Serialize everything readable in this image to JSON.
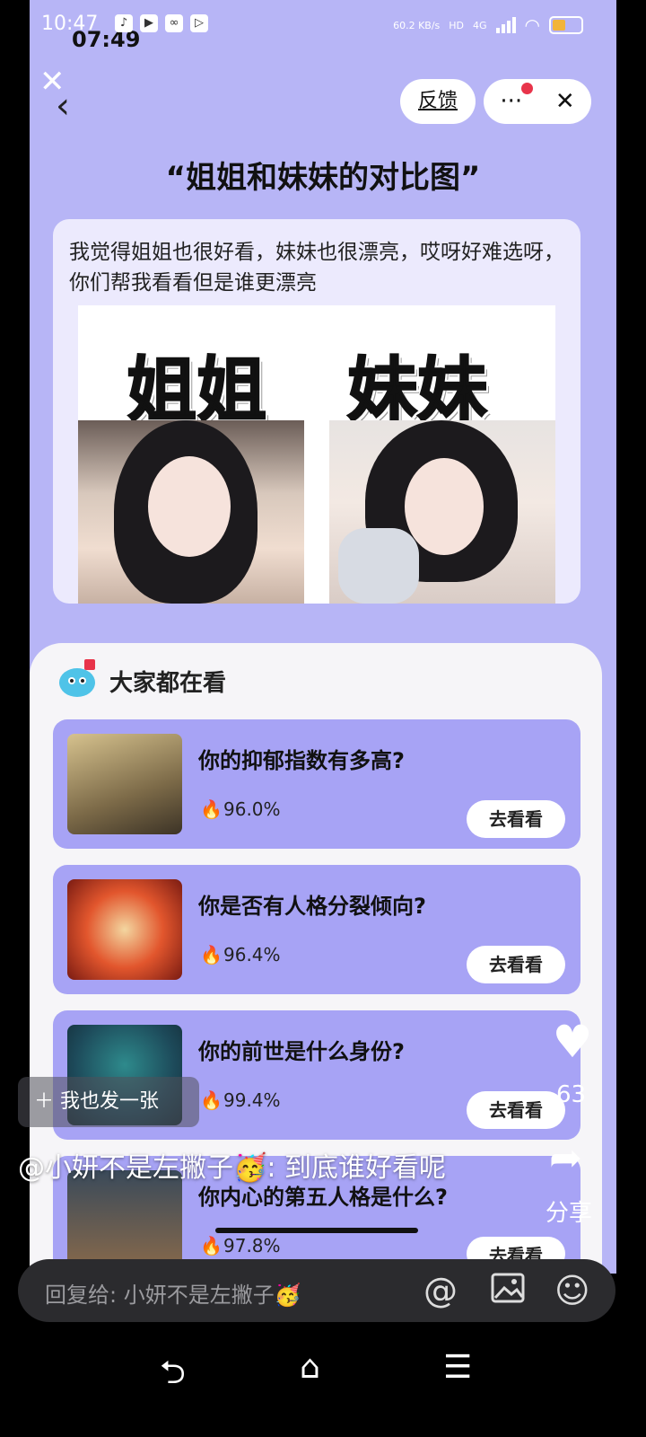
{
  "status_bar": {
    "time_primary": "10:47",
    "time_overlay": "07:49",
    "net_speed": "60.2 KB/s",
    "network": "4G",
    "hd_label": "HD"
  },
  "header": {
    "feedback_label": "反馈",
    "more_label": "···",
    "close_label": "✕"
  },
  "post": {
    "title": "“姐姐和妹妹的对比图”",
    "text": "我觉得姐姐也很好看，妹妹也很漂亮，哎呀好难选呀，你们帮我看看但是谁更漂亮",
    "image": {
      "left_label": "姐姐",
      "right_label": "妹妹"
    }
  },
  "recommend": {
    "title": "大家都在看",
    "items": [
      {
        "title": "你的抑郁指数有多高?",
        "percent": "96.0%",
        "button": "去看看"
      },
      {
        "title": "你是否有人格分裂倾向?",
        "percent": "96.4%",
        "button": "去看看"
      },
      {
        "title": "你的前世是什么身份?",
        "percent": "99.4%",
        "button": "去看看"
      },
      {
        "title": "你内心的第五人格是什么?",
        "percent": "97.8%",
        "button": "去看看"
      }
    ]
  },
  "overlay": {
    "also_post": "＋ 我也发一张",
    "like_count": "63",
    "share_label": "分享",
    "comment": "@小妍不是左撇子🥳: 到底谁好看呢"
  },
  "reply": {
    "placeholder": "回复给: 小妍不是左撇子🥳"
  },
  "colors": {
    "background": "#b7b5f6",
    "card": "#a7a3f5",
    "accent_red": "#e8344a"
  }
}
